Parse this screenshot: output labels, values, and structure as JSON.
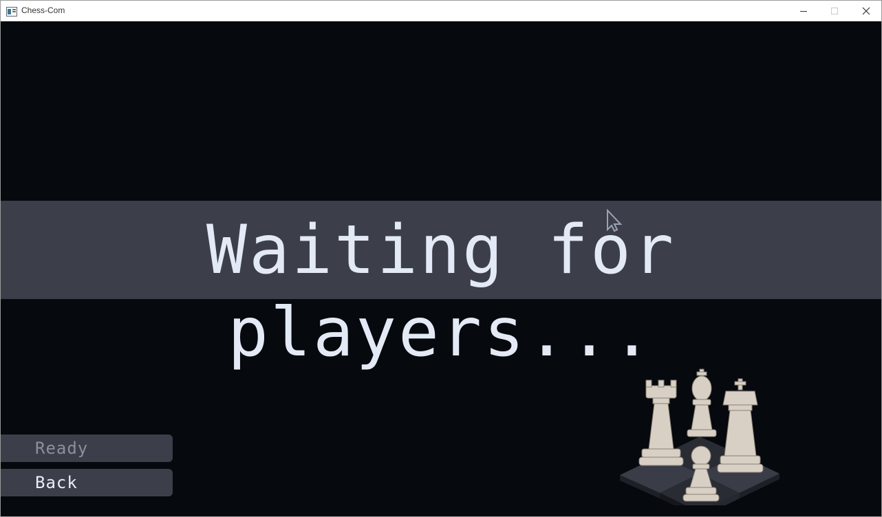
{
  "window": {
    "title": "Chess-Com",
    "controls": {
      "minimize_icon": "minimize-icon",
      "maximize_icon": "maximize-icon",
      "close_icon": "close-icon"
    }
  },
  "screen": {
    "status_text": "Waiting for players...",
    "buttons": {
      "ready_label": "Ready",
      "back_label": "Back"
    },
    "art_icon": "chess-pieces-icon",
    "colors": {
      "background": "#06090d",
      "banner": "#3c3f4a",
      "text": "#e3eaf6",
      "disabled_text": "#8b909b"
    }
  }
}
